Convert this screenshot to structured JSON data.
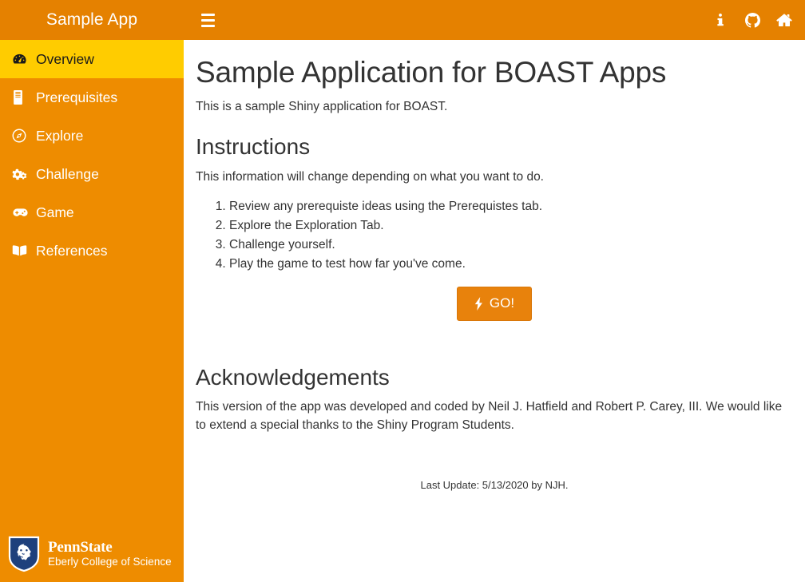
{
  "header": {
    "brand": "Sample App",
    "toggle_icon": "hamburger-icon",
    "nav": [
      {
        "icon": "info-icon",
        "label": "i"
      },
      {
        "icon": "github-icon",
        "label": ""
      },
      {
        "icon": "home-icon",
        "label": ""
      }
    ]
  },
  "sidebar": {
    "background_color": "#ee8c00",
    "active_color": "#ffcc00",
    "items": [
      {
        "label": "Overview",
        "icon": "tachometer-icon",
        "active": true
      },
      {
        "label": "Prerequisites",
        "icon": "book-icon",
        "active": false
      },
      {
        "label": "Explore",
        "icon": "compass-icon",
        "active": false
      },
      {
        "label": "Challenge",
        "icon": "cogs-icon",
        "active": false
      },
      {
        "label": "Game",
        "icon": "gamepad-icon",
        "active": false
      },
      {
        "label": "References",
        "icon": "book-open-icon",
        "active": false
      }
    ],
    "logo": {
      "icon": "penn-state-shield-icon",
      "name": "PennState",
      "subtitle": "Eberly College of Science"
    }
  },
  "main": {
    "title": "Sample Application for BOAST Apps",
    "intro": "This is a sample Shiny application for BOAST.",
    "instructions_heading": "Instructions",
    "instructions_intro": "This information will change depending on what you want to do.",
    "steps": [
      "Review any prerequiste ideas using the Prerequistes tab.",
      "Explore the Exploration Tab.",
      "Challenge yourself.",
      "Play the game to test how far you've come."
    ],
    "go_button": {
      "label": "GO!",
      "icon": "bolt-icon",
      "color": "#e8820c"
    },
    "acknowledgements_heading": "Acknowledgements",
    "acknowledgements_text": "This version of the app was developed and coded by Neil J. Hatfield and Robert P. Carey, III. We would like to extend a special thanks to the Shiny Program Students.",
    "last_update": "Last Update: 5/13/2020 by NJH."
  }
}
